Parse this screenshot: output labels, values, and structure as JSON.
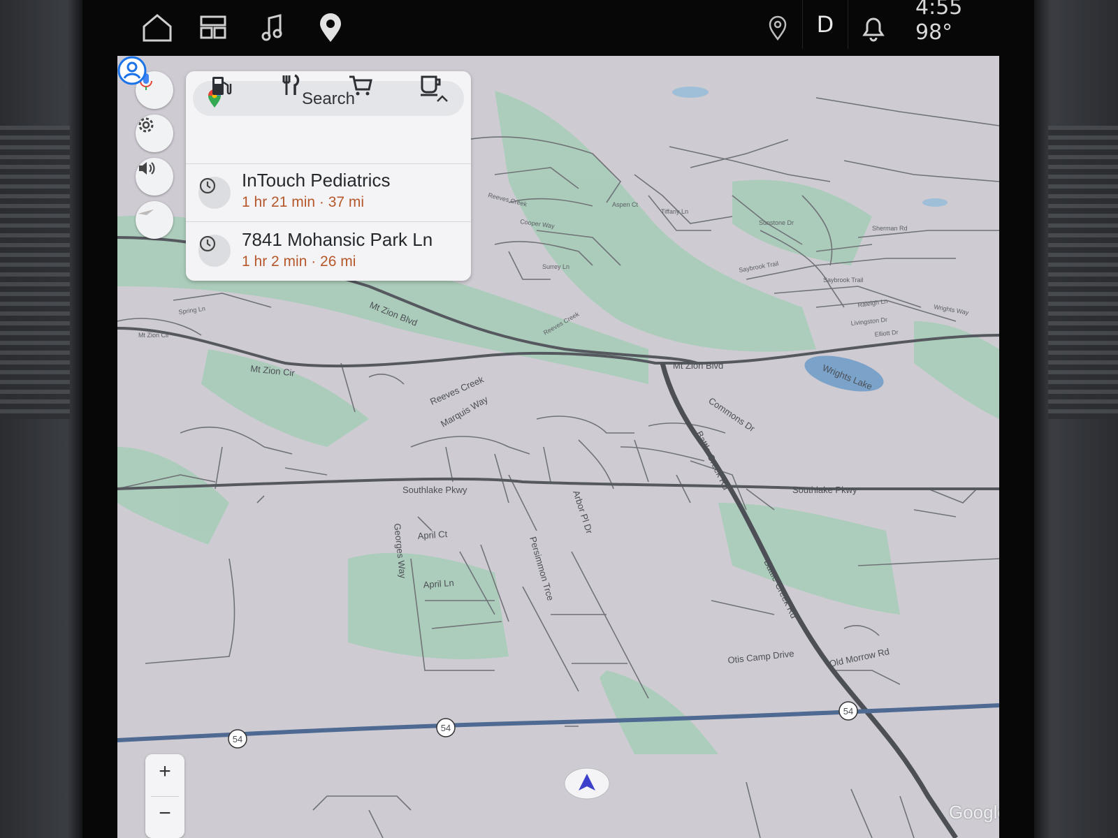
{
  "status_bar": {
    "gear": "D",
    "time": "4:55",
    "temperature": "98°",
    "icons": [
      "home-icon",
      "dashboard-icon",
      "music-icon",
      "maps-pin-icon",
      "location-pin-icon",
      "bell-icon"
    ]
  },
  "map_controls": [
    "microphone-icon",
    "settings-gear-icon",
    "volume-icon",
    "compass-icon"
  ],
  "search_panel": {
    "search_label": "Search",
    "categories": [
      "gas-station-icon",
      "restaurant-icon",
      "grocery-cart-icon",
      "coffee-cup-icon"
    ],
    "recents": [
      {
        "name": "InTouch Pediatrics",
        "meta": "1 hr 21 min · 37 mi"
      },
      {
        "name": "7841 Mohansic Park Ln",
        "meta": "1 hr 2 min · 26 mi"
      }
    ]
  },
  "map_labels": {
    "mt_zion_blvd_1": "Mt Zion Blvd",
    "mt_zion_blvd_2": "Mt Zion Blvd",
    "mt_zion_cir_1": "Mt Zion Cir",
    "mt_zion_cir_2": "Mt Zion Cir",
    "spring_ln": "Spring Ln",
    "reeves_creek_1": "Reeves Creek",
    "reeves_creek_2": "Reeves Creek",
    "reeves_creek_3": "Reeves Creek",
    "marquis_way": "Marquis Way",
    "commons_dr": "Commons Dr",
    "battle_creek_rd_1": "Battle Creek Rd",
    "battle_creek_rd_2": "Battle Creek Rd",
    "wrights_lake": "Wrights Lake",
    "southlake_pkwy_1": "Southlake Pkwy",
    "southlake_pkwy_2": "Southlake Pkwy",
    "april_ct": "April Ct",
    "april_ln": "April Ln",
    "georges_way": "Georges Way",
    "persimmon_trce": "Persimmon Trce",
    "arbor_pl_dr": "Arbor Pl Dr",
    "otis_camp_drive": "Otis Camp Drive",
    "old_morrow_rd": "Old Morrow Rd",
    "raleigh_ln": "Raleigh Ln",
    "livingston_dr": "Livingston Dr",
    "elliott_dr": "Elliott Dr",
    "wrights_way": "Wrights Way",
    "saybrook_trail_1": "Saybrook Trail",
    "saybrook_trail_2": "Saybrook Trail",
    "surrey_ln": "Surrey Ln",
    "cooper_way": "Cooper Way",
    "aspen_ct": "Aspen Ct",
    "tiffany_ln": "Tiffany Ln",
    "sunstone_dr": "Sunstone Dr",
    "sherman_rd": "Sherman Rd",
    "route_54": "54"
  },
  "zoom": {
    "plus": "+",
    "minus": "−"
  },
  "attribution": "Google"
}
